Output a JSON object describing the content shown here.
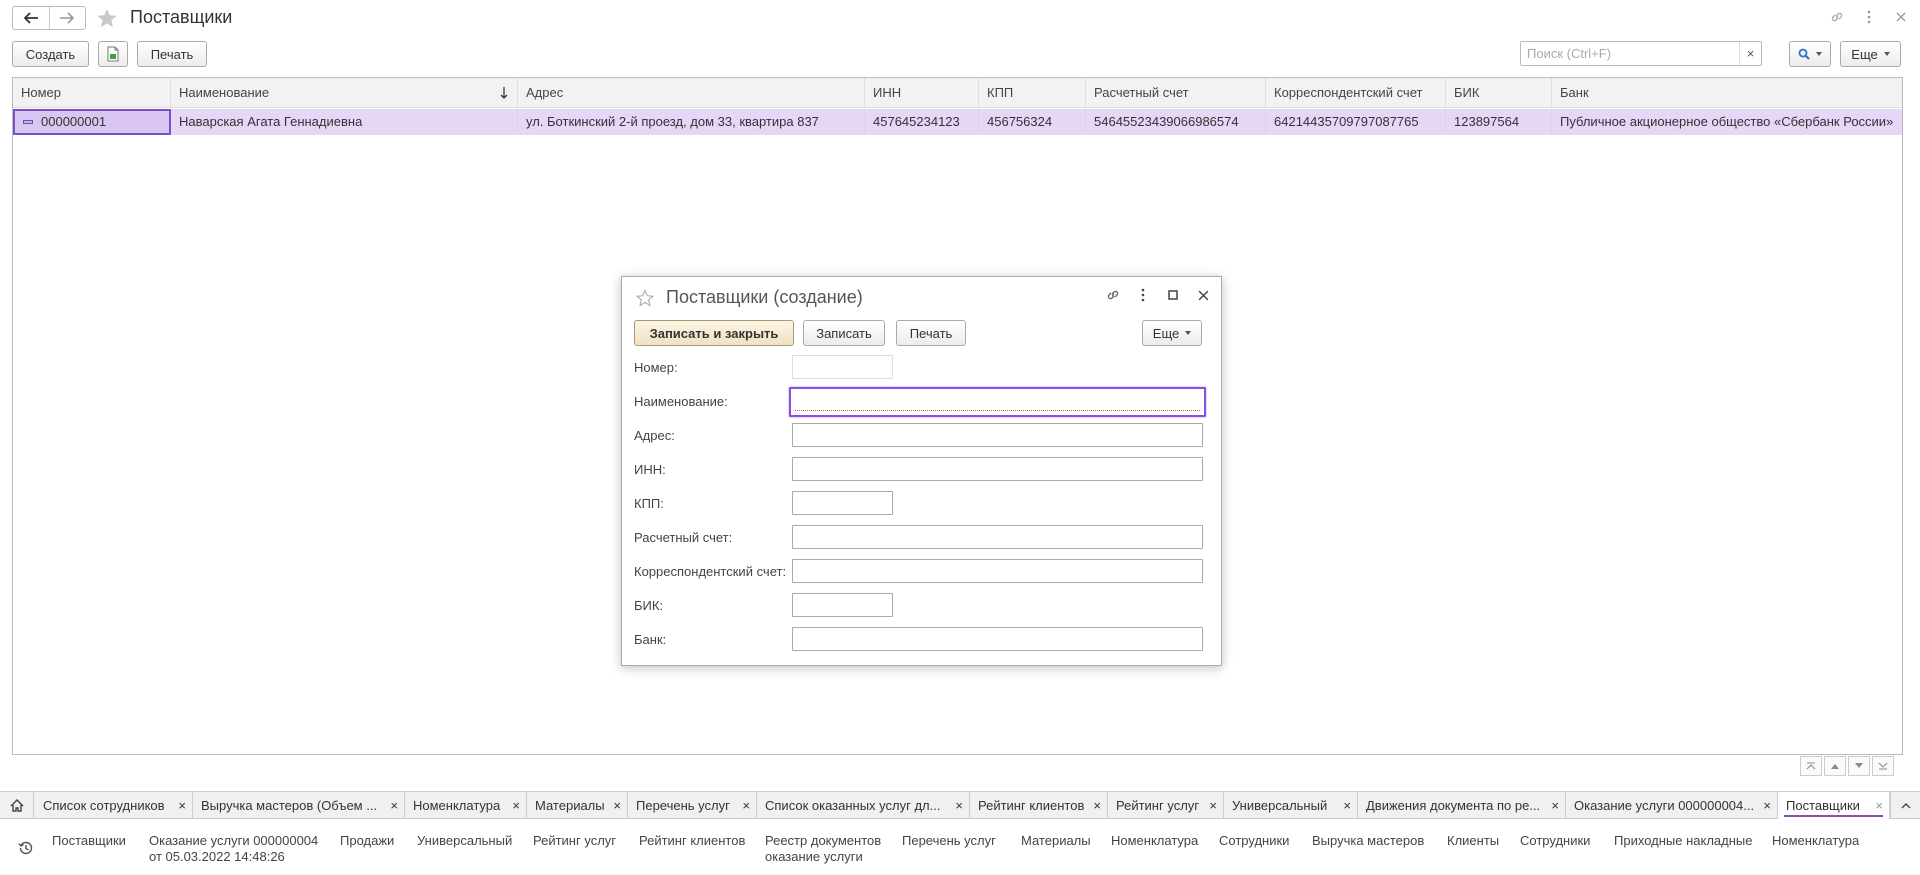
{
  "header": {
    "title": "Поставщики"
  },
  "toolbar": {
    "create_label": "Создать",
    "print_label": "Печать",
    "search_placeholder": "Поиск (Ctrl+F)",
    "search_clear": "×",
    "more_label": "Еще"
  },
  "grid": {
    "columns": [
      "Номер",
      "Наименование",
      "Адрес",
      "ИНН",
      "КПП",
      "Расчетный счет",
      "Корреспондентский счет",
      "БИК",
      "Банк"
    ],
    "sort_column": "Наименование",
    "rows": [
      [
        "000000001",
        "Наварская Агата Геннадиевна",
        "ул. Боткинский 2-й проезд, дом 33, квартира 837",
        "457645234123",
        "456756324",
        "54645523439066986574",
        "64214435709797087765",
        "123897564",
        "Публичное акционерное общество «Сбербанк России»"
      ]
    ]
  },
  "dialog": {
    "title": "Поставщики (создание)",
    "save_close_label": "Записать и закрыть",
    "save_label": "Записать",
    "print_label": "Печать",
    "more_label": "Еще",
    "fields": {
      "number": "Номер:",
      "name": "Наименование:",
      "address": "Адрес:",
      "inn": "ИНН:",
      "kpp": "КПП:",
      "account": "Расчетный счет:",
      "corr_account": "Корреспондентский счет:",
      "bik": "БИК:",
      "bank": "Банк:"
    }
  },
  "tabs": [
    "Список сотрудников",
    "Выручка мастеров (Объем ...",
    "Номенклатура",
    "Материалы",
    "Перечень услуг",
    "Список оказанных услуг дл...",
    "Рейтинг клиентов",
    "Рейтинг услуг",
    "Универсальный",
    "Движения документа по ре...",
    "Оказание услуги 000000004...",
    "Поставщики"
  ],
  "tab_close": "×",
  "history": {
    "items": [
      "Поставщики",
      "Оказание услуги 000000004",
      "Продажи",
      "Универсальный",
      "Рейтинг услуг",
      "Рейтинг клиентов",
      "Реестр документов",
      "Перечень услуг",
      "Материалы",
      "Номенклатура",
      "Сотрудники",
      "Выручка мастеров",
      "Клиенты",
      "Сотрудники",
      "Приходные накладные",
      "Номенклатура"
    ],
    "item1_line2": "от 05.03.2022 14:48:26",
    "item6_line2": "оказание услуги"
  },
  "colors": {
    "selected_row": "#e6d7f7",
    "active_field_border": "#8a4fe0",
    "active_tab_underline": "#8a4fb0"
  }
}
